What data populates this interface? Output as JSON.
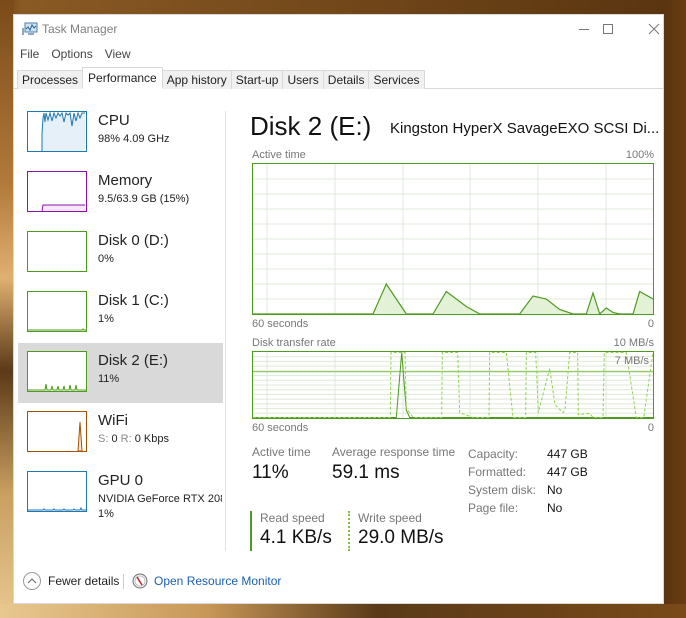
{
  "window": {
    "title": "Task Manager",
    "controls": {
      "minimize": "minimize",
      "maximize": "maximize",
      "close": "close"
    }
  },
  "menu": [
    "File",
    "Options",
    "View"
  ],
  "tabs": [
    {
      "label": "Processes",
      "active": false
    },
    {
      "label": "Performance",
      "active": true
    },
    {
      "label": "App history",
      "active": false
    },
    {
      "label": "Start-up",
      "active": false
    },
    {
      "label": "Users",
      "active": false
    },
    {
      "label": "Details",
      "active": false
    },
    {
      "label": "Services",
      "active": false
    }
  ],
  "sidebar": [
    {
      "title": "CPU",
      "sub": "98%  4.09 GHz",
      "color": "#1f77b4",
      "fill": "#e6f0f8",
      "selected": false
    },
    {
      "title": "Memory",
      "sub": "9.5/63.9 GB (15%)",
      "color": "#8b12ae",
      "fill": "#f4e8f7",
      "selected": false
    },
    {
      "title": "Disk 0 (D:)",
      "sub": "0%",
      "color": "#4d9a1f",
      "fill": "#eef6e6",
      "selected": false
    },
    {
      "title": "Disk 1 (C:)",
      "sub": "1%",
      "color": "#4d9a1f",
      "fill": "#eef6e6",
      "selected": false
    },
    {
      "title": "Disk 2 (E:)",
      "sub": "11%",
      "color": "#4d9a1f",
      "fill": "#eef6e6",
      "selected": true
    },
    {
      "title": "WiFi",
      "sub_send_label": "S:",
      "sub_send": "0",
      "sub_recv_label": "R:",
      "sub_recv": "0 Kbps",
      "color": "#a74f01",
      "fill": "#f6ebe0",
      "selected": false
    },
    {
      "title": "GPU 0",
      "sub": "NVIDIA GeForce RTX 208",
      "sub2": "1%",
      "color": "#1f77b4",
      "fill": "#e6f0f8",
      "selected": false
    }
  ],
  "main": {
    "title": "Disk 2 (E:)",
    "model": "Kingston HyperX SavageEXO SCSI Di...",
    "active_graph": {
      "label": "Active time",
      "max_label": "100%",
      "x_left": "60 seconds",
      "x_right": "0"
    },
    "transfer_graph": {
      "label": "Disk transfer rate",
      "max_label": "10 MB/s",
      "ref_label": "7 MB/s",
      "x_left": "60 seconds",
      "x_right": "0"
    },
    "stats": {
      "active_time_label": "Active time",
      "active_time_value": "11%",
      "avg_response_label": "Average response time",
      "avg_response_value": "59.1 ms",
      "read_speed_label": "Read speed",
      "read_speed_value": "4.1 KB/s",
      "write_speed_label": "Write speed",
      "write_speed_value": "29.0 MB/s"
    },
    "properties": [
      {
        "label": "Capacity:",
        "value": "447 GB"
      },
      {
        "label": "Formatted:",
        "value": "447 GB"
      },
      {
        "label": "System disk:",
        "value": "No"
      },
      {
        "label": "Page file:",
        "value": "No"
      }
    ]
  },
  "footer": {
    "fewer_details": "Fewer details",
    "resource_monitor": "Open Resource Monitor"
  },
  "chart_data": [
    {
      "type": "area",
      "title": "Active time",
      "xlabel": "seconds ago",
      "ylabel": "Active time (%)",
      "ylim": [
        0,
        100
      ],
      "xlim": [
        60,
        0
      ],
      "grid": true,
      "x": [
        60,
        54,
        49,
        43,
        42,
        40,
        37,
        35,
        33,
        31,
        28,
        26,
        24,
        22,
        20,
        18,
        16,
        14,
        12,
        11,
        10,
        9,
        8,
        7,
        6,
        5,
        3,
        2,
        0
      ],
      "values": [
        0,
        0,
        0,
        0,
        0,
        20,
        0,
        0,
        0,
        15,
        5,
        0,
        0,
        0,
        0,
        12,
        10,
        3,
        0,
        0,
        0,
        14,
        0,
        4,
        1,
        0,
        0,
        15,
        10
      ],
      "line_color": "#4d9a1f",
      "fill_color": "#e3f2d7"
    },
    {
      "type": "line",
      "title": "Disk transfer rate",
      "ylabel": "MB/s",
      "ylim": [
        0,
        10
      ],
      "xlim": [
        60,
        0
      ],
      "reference_line": 7,
      "grid": true,
      "series": [
        {
          "name": "Read speed",
          "style": "solid",
          "x": [
            60,
            38.5,
            37.7,
            37,
            36.5,
            0
          ],
          "values": [
            0,
            0,
            10,
            1.2,
            0,
            0
          ]
        },
        {
          "name": "Write speed",
          "style": "dashed",
          "x": [
            60,
            39.4,
            39.3,
            37.2,
            37,
            36,
            31.7,
            31.6,
            29.3,
            29,
            27,
            24.6,
            24.5,
            22,
            21,
            19.1,
            19,
            17.6,
            17.2,
            15.5,
            14.7,
            13.5,
            13.2,
            12.5,
            11.3,
            11.2,
            9.5,
            9,
            7.5,
            7.3,
            4,
            2.5,
            1.4,
            0
          ],
          "values": [
            0,
            0,
            10,
            10,
            1.5,
            0,
            0,
            10,
            10,
            0.8,
            0,
            0,
            10,
            10,
            0,
            0,
            10,
            10,
            0.8,
            7.5,
            2,
            0.8,
            1.3,
            10,
            10,
            0.5,
            0.7,
            0,
            0,
            10,
            10,
            0,
            0,
            10
          ]
        }
      ]
    }
  ]
}
